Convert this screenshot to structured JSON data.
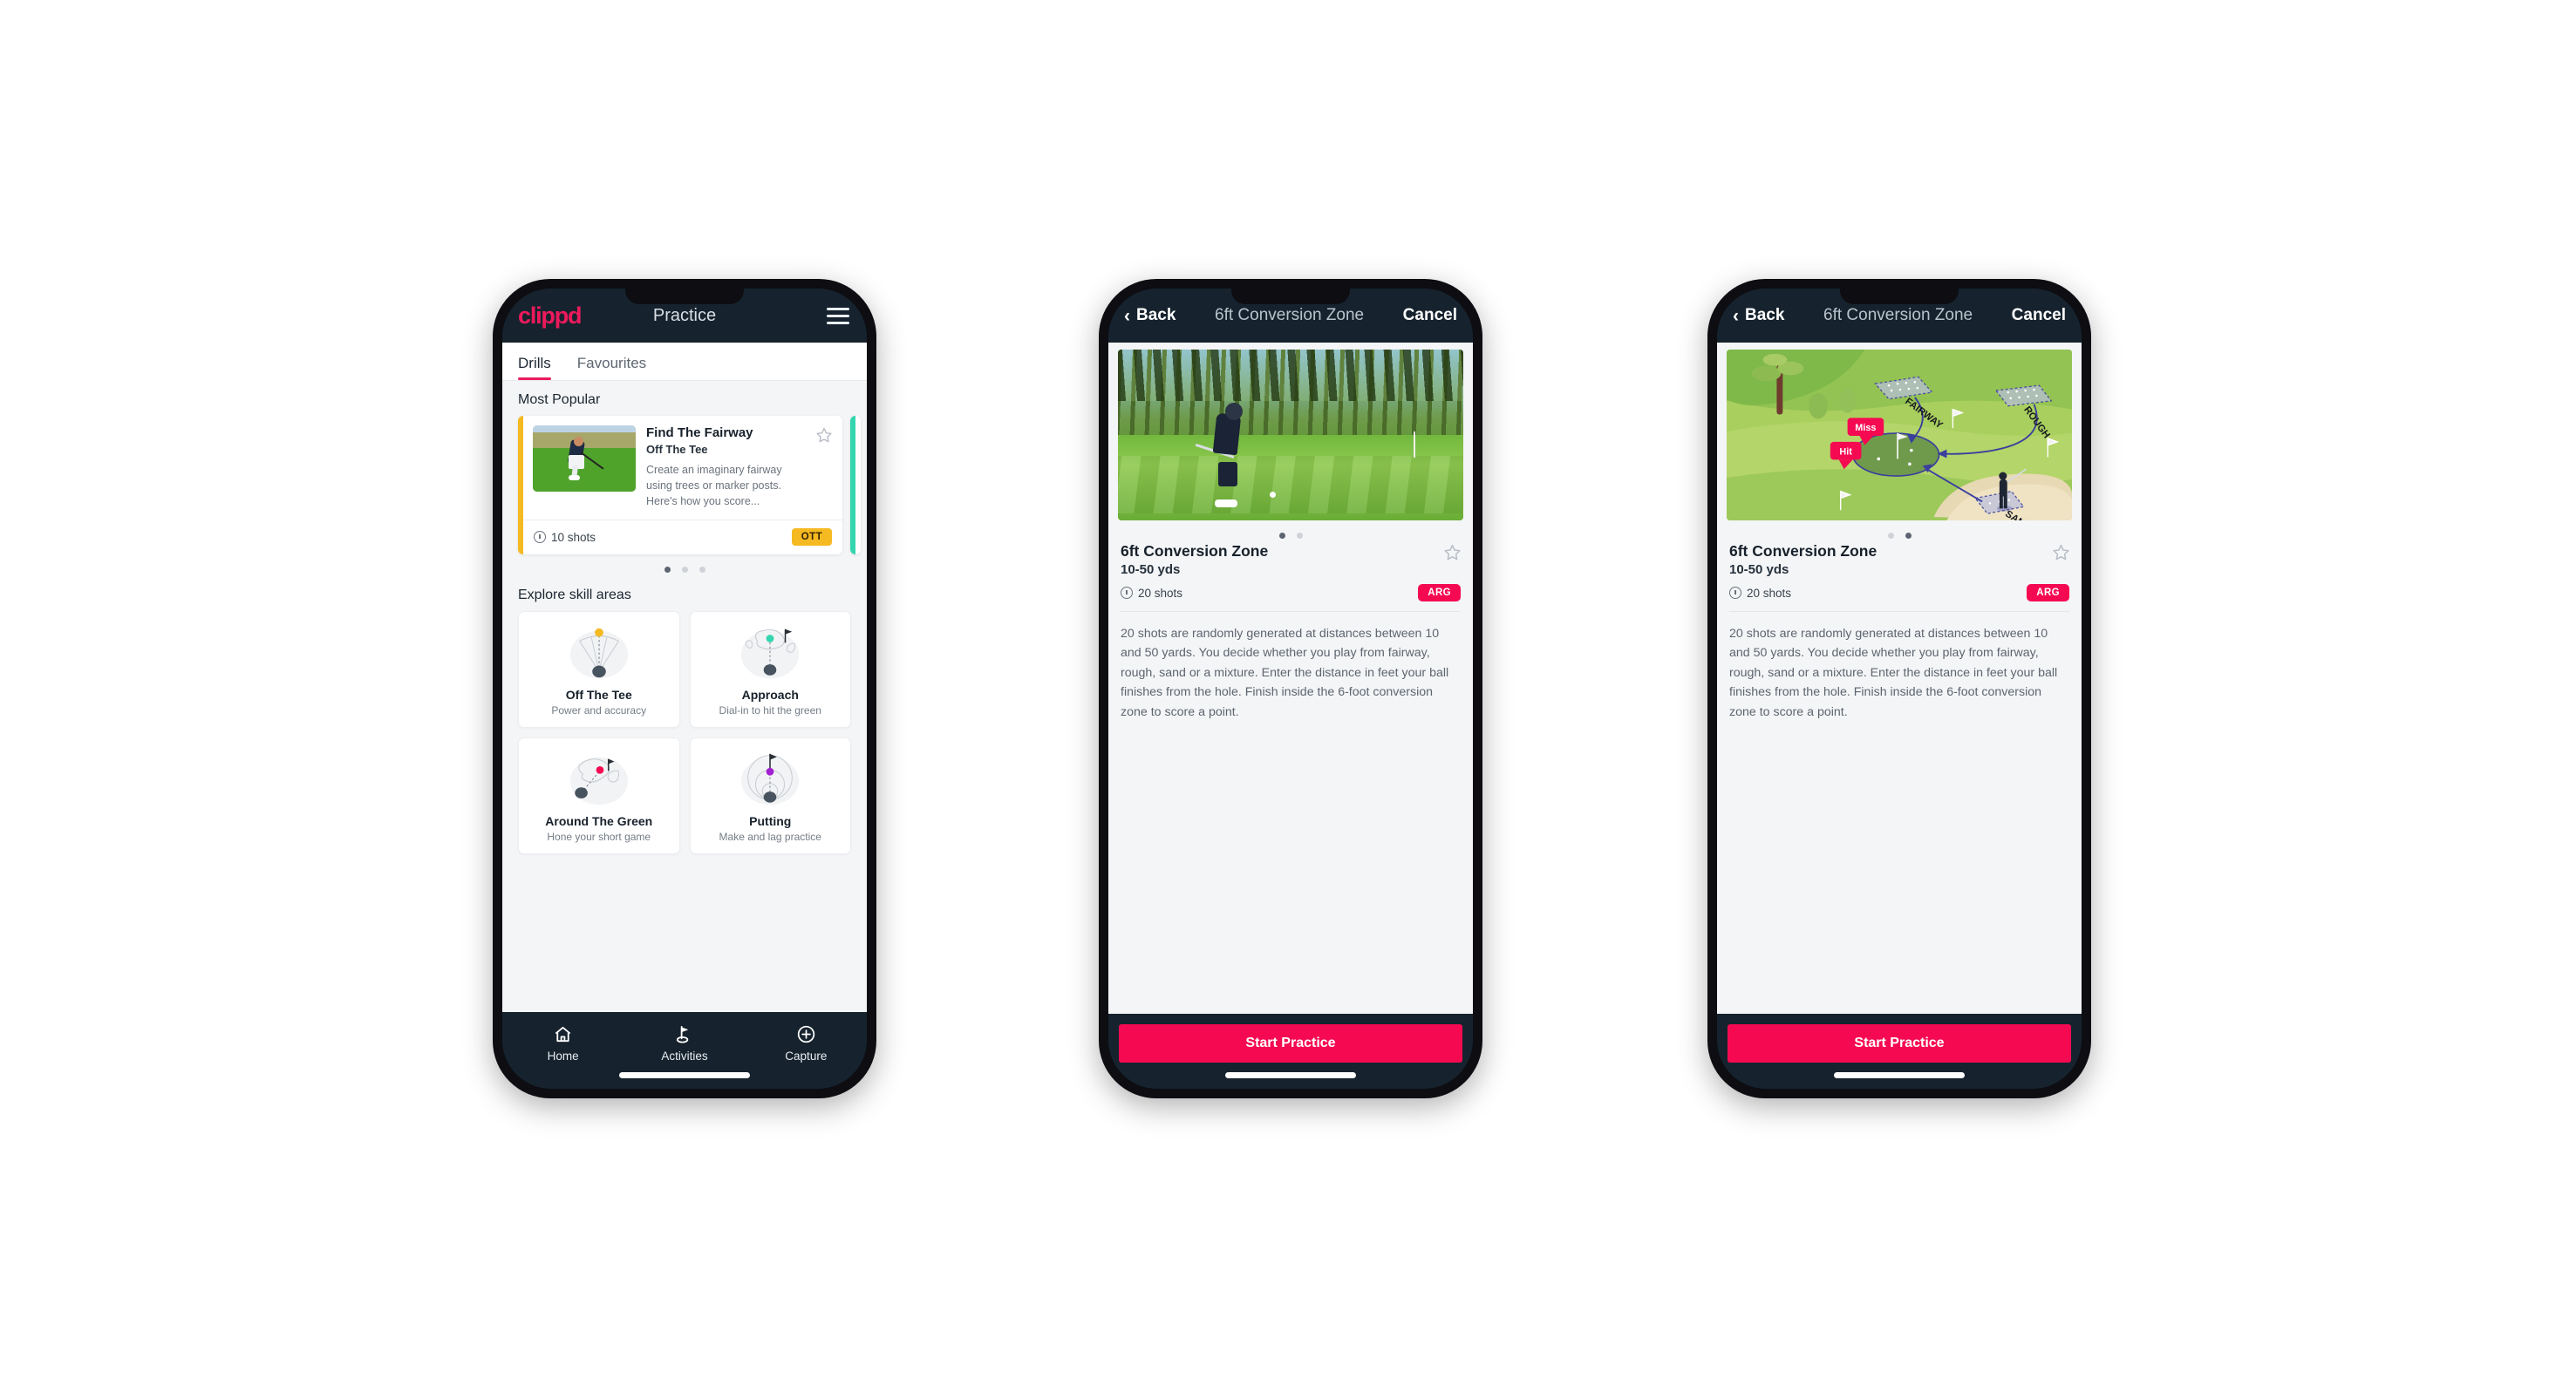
{
  "app": {
    "brand": "clippd",
    "accent_pink": "#ec1a5c",
    "accent_amber": "#f5b921",
    "accent_teal": "#33d6ae",
    "header_bg": "#16232e",
    "cta_color": "#f50a52"
  },
  "phone1": {
    "header": {
      "brand": "clippd",
      "title": "Practice",
      "menu_icon": "hamburger-icon"
    },
    "tabs": [
      {
        "label": "Drills",
        "active": true
      },
      {
        "label": "Favourites",
        "active": false
      }
    ],
    "sections": {
      "most_popular_label": "Most Popular",
      "explore_label": "Explore skill areas"
    },
    "featured_drill": {
      "title": "Find The Fairway",
      "subtitle": "Off The Tee",
      "description": "Create an imaginary fairway using trees or marker posts. Here's how you score...",
      "shots": "10 shots",
      "badge": "OTT",
      "accent": "#f5b921",
      "star_icon": "star-outline-icon",
      "clock_icon": "clock-icon"
    },
    "carousel_dots": {
      "count": 3,
      "active_index": 0
    },
    "skill_areas": [
      {
        "name": "Off The Tee",
        "desc": "Power and accuracy",
        "icon": "tee-fan-icon",
        "dot_color": "#f5b921"
      },
      {
        "name": "Approach",
        "desc": "Dial-in to hit the green",
        "icon": "approach-green-icon",
        "dot_color": "#33d6ae"
      },
      {
        "name": "Around The Green",
        "desc": "Hone your short game",
        "icon": "chip-green-icon",
        "dot_color": "#f50a52"
      },
      {
        "name": "Putting",
        "desc": "Make and lag practice",
        "icon": "putting-rings-icon",
        "dot_color": "#a01fd0"
      }
    ],
    "tabbar": [
      {
        "label": "Home",
        "icon": "home-icon",
        "active": false
      },
      {
        "label": "Activities",
        "icon": "golf-flag-icon",
        "active": true
      },
      {
        "label": "Capture",
        "icon": "plus-circle-icon",
        "active": false
      }
    ]
  },
  "phone2": {
    "navbar": {
      "back": "Back",
      "title": "6ft Conversion Zone",
      "cancel": "Cancel",
      "back_icon": "chevron-left-icon"
    },
    "hero": {
      "type": "photo",
      "alt": "golfer chipping on course"
    },
    "dots": {
      "count": 2,
      "active_index": 0
    },
    "drill": {
      "title": "6ft Conversion Zone",
      "yards": "10-50 yds",
      "shots": "20 shots",
      "badge": "ARG",
      "star_icon": "star-outline-icon",
      "clock_icon": "clock-icon",
      "description": "20 shots are randomly generated at distances between 10 and 50 yards. You decide whether you play from fairway, rough, sand or a mixture. Enter the distance in feet your ball finishes from the hole. Finish inside the 6-foot conversion zone to score a point."
    },
    "cta": "Start Practice"
  },
  "phone3": {
    "navbar": {
      "back": "Back",
      "title": "6ft Conversion Zone",
      "cancel": "Cancel",
      "back_icon": "chevron-left-icon"
    },
    "hero": {
      "type": "diagram",
      "labels": {
        "fairway": "FAIRWAY",
        "rough": "ROUGH",
        "sand": "SAND",
        "miss": "Miss",
        "hit": "Hit"
      }
    },
    "dots": {
      "count": 2,
      "active_index": 1
    },
    "drill": {
      "title": "6ft Conversion Zone",
      "yards": "10-50 yds",
      "shots": "20 shots",
      "badge": "ARG",
      "star_icon": "star-outline-icon",
      "clock_icon": "clock-icon",
      "description": "20 shots are randomly generated at distances between 10 and 50 yards. You decide whether you play from fairway, rough, sand or a mixture. Enter the distance in feet your ball finishes from the hole. Finish inside the 6-foot conversion zone to score a point."
    },
    "cta": "Start Practice"
  }
}
